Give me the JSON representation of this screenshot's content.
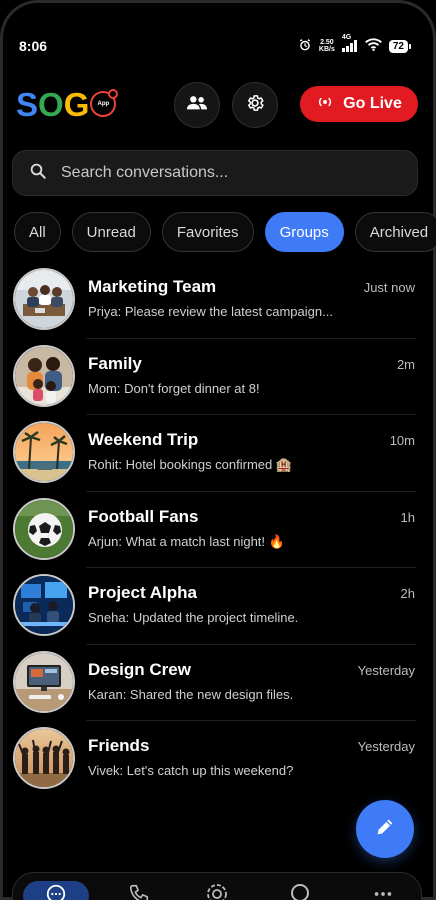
{
  "status": {
    "time": "8:06",
    "speed_value": "2.50",
    "speed_unit": "KB/s",
    "network": "4G",
    "battery": "72"
  },
  "header": {
    "logo_letters": [
      "S",
      "O",
      "G"
    ],
    "logo_badge": "App",
    "go_live_label": "Go Live",
    "icons": {
      "people": "people-icon",
      "settings": "gear-icon",
      "live": "live-broadcast-icon"
    }
  },
  "search": {
    "placeholder": "Search conversations..."
  },
  "filters": [
    {
      "label": "All",
      "active": false
    },
    {
      "label": "Unread",
      "active": false
    },
    {
      "label": "Favorites",
      "active": false
    },
    {
      "label": "Groups",
      "active": true
    },
    {
      "label": "Archived",
      "active": false
    }
  ],
  "conversations": [
    {
      "name": "Marketing Team",
      "preview": "Priya: Please review the latest campaign...",
      "time": "Just now"
    },
    {
      "name": "Family",
      "preview": "Mom: Don't forget dinner at 8!",
      "time": "2m"
    },
    {
      "name": "Weekend Trip",
      "preview": "Rohit: Hotel bookings confirmed 🏨",
      "time": "10m"
    },
    {
      "name": "Football Fans",
      "preview": "Arjun: What a match last night! 🔥",
      "time": "1h"
    },
    {
      "name": "Project Alpha",
      "preview": "Sneha: Updated the project timeline.",
      "time": "2h"
    },
    {
      "name": "Design Crew",
      "preview": "Karan: Shared the new design files.",
      "time": "Yesterday"
    },
    {
      "name": "Friends",
      "preview": "Vivek: Let's catch up this weekend?",
      "time": "Yesterday"
    }
  ],
  "fab": {
    "icon": "pencil-icon"
  },
  "bottom_nav": {
    "icons": [
      "chat-icon",
      "calls-icon",
      "status-icon",
      "search-icon",
      "more-icon"
    ],
    "active": "chat-icon"
  },
  "colors": {
    "accent": "#3f7bf6",
    "live": "#e21b23",
    "background": "#000000"
  }
}
